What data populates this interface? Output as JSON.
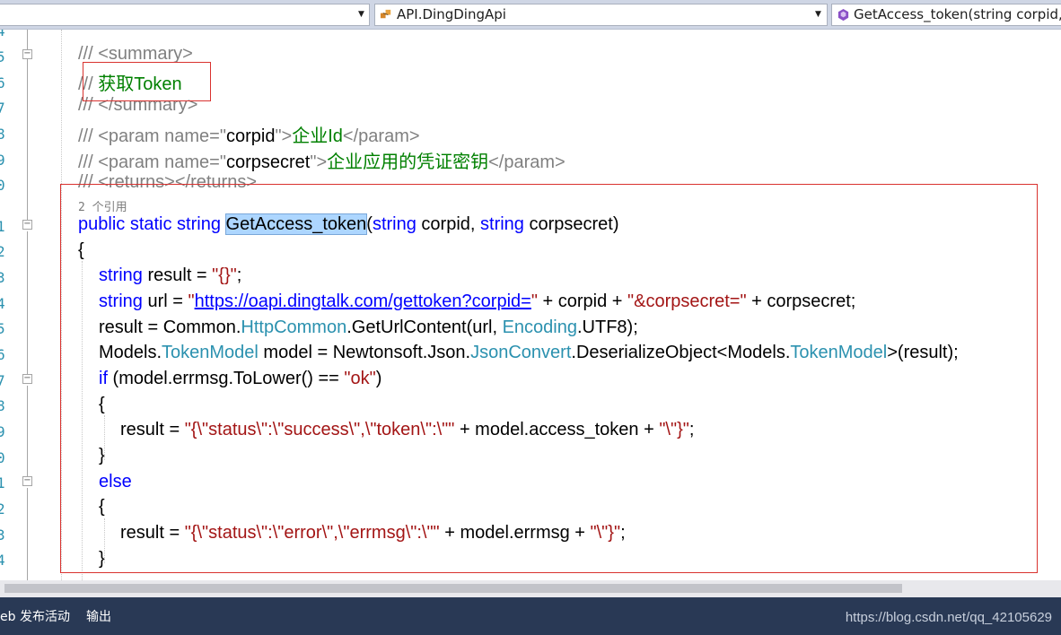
{
  "navbar": {
    "type_combo": "API.DingDingApi",
    "member_combo": "GetAccess_token(string corpid,"
  },
  "editor": {
    "line_numbers": [
      "4",
      "5",
      "6",
      "7",
      "8",
      "9",
      "0",
      "",
      "1",
      "2",
      "3",
      "4",
      "5",
      "6",
      "7",
      "8",
      "9",
      "0",
      "1",
      "2",
      "3",
      "4"
    ],
    "codelens": "2 个引用",
    "lines": {
      "l1": "/// <summary>",
      "l2_prefix": "/// ",
      "l2_text": "获取Token",
      "l3": "/// </summary>",
      "l4a": "/// <param name=\"",
      "l4b": "corpid",
      "l4c": "\">",
      "l4d": "企业Id",
      "l4e": "</param>",
      "l5a": "/// <param name=\"",
      "l5b": "corpsecret",
      "l5c": "\">",
      "l5d": "企业应用的凭证密钥",
      "l5e": "</param>",
      "l6": "/// <returns></returns>",
      "sig_kw": "public static string",
      "sig_name": "GetAccess_token",
      "sig_p1": "(",
      "sig_t1": "string",
      "sig_p2": " corpid, ",
      "sig_t2": "string",
      "sig_p3": " corpsecret)",
      "brace_open": "{",
      "r1_t": "string",
      "r1_a": " result = ",
      "r1_s": "\"{}\"",
      "r1_b": ";",
      "r2_t": "string",
      "r2_a": " url = ",
      "r2_q": "\"",
      "r2_url": "https://oapi.dingtalk.com/gettoken?corpid=",
      "r2_q2": "\"",
      "r2_b": " + corpid + ",
      "r2_s": "\"&corpsecret=\"",
      "r2_c": " + corpsecret;",
      "r3_a": "result = Common.",
      "r3_t": "HttpCommon",
      "r3_b": ".GetUrlContent(url, ",
      "r3_t2": "Encoding",
      "r3_c": ".UTF8);",
      "r4_a": "Models.",
      "r4_t": "TokenModel",
      "r4_b": " model = Newtonsoft.Json.",
      "r4_t2": "JsonConvert",
      "r4_c": ".DeserializeObject<Models.",
      "r4_t3": "TokenModel",
      "r4_d": ">(result);",
      "r5_k": "if",
      "r5_a": " (model.errmsg.ToLower() == ",
      "r5_s": "\"ok\"",
      "r5_b": ")",
      "r6": "{",
      "r7_a": "result = ",
      "r7_s": "\"{\\\"status\\\":\\\"success\\\",\\\"token\\\":\\\"\"",
      "r7_b": " + model.access_token + ",
      "r7_s2": "\"\\\"}\"",
      "r7_c": ";",
      "r8": "}",
      "r9_k": "else",
      "r10": "{",
      "r11_a": "result = ",
      "r11_s": "\"{\\\"status\\\":\\\"error\\\",\\\"errmsg\\\":\\\"\"",
      "r11_b": " + model.errmsg + ",
      "r11_s2": "\"\\\"}\"",
      "r11_c": ";",
      "r12": "}"
    }
  },
  "bottombar": {
    "tab1": "eb 发布活动",
    "tab2": "输出",
    "watermark": "https://blog.csdn.net/qq_42105629"
  },
  "colors": {
    "keyword": "#0000ff",
    "string": "#a31515",
    "comment": "#008000",
    "doc_comment": "#808080",
    "type": "#2b91af",
    "annotation_box": "#d9322f"
  }
}
